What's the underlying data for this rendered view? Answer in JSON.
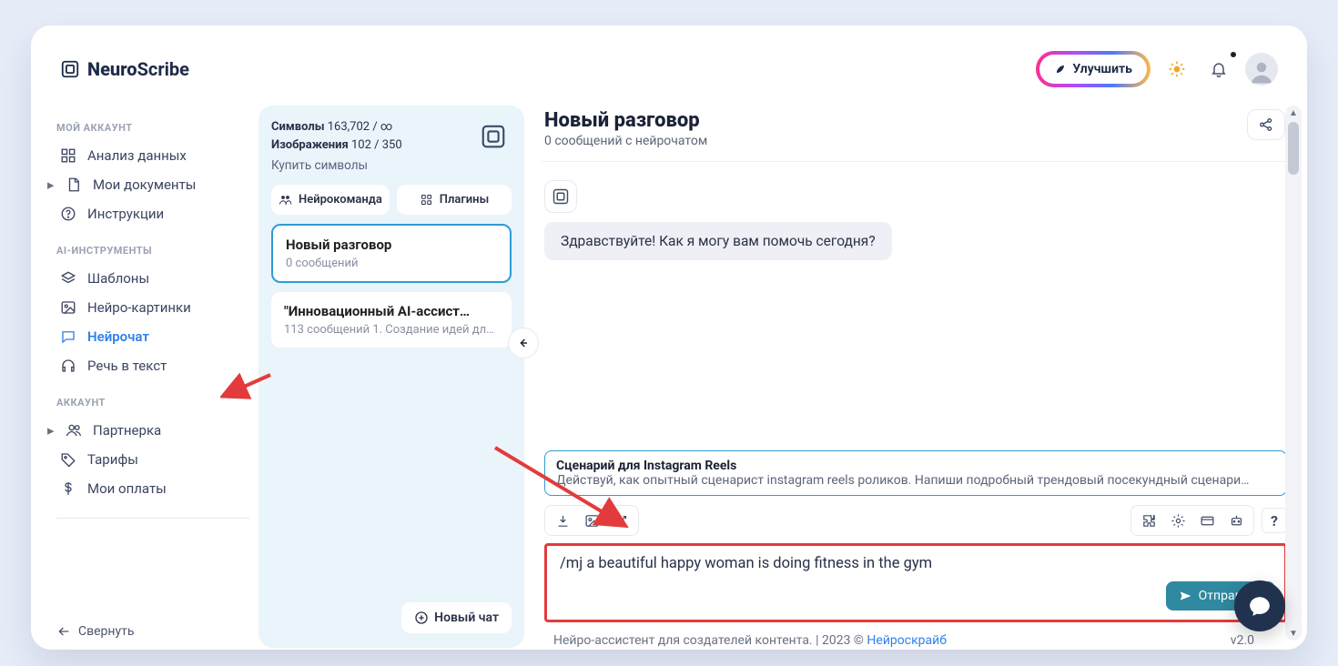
{
  "brand": {
    "bold": "Neuro",
    "light": "Scribe"
  },
  "topbar": {
    "upgrade": "Улучшить"
  },
  "sidebar": {
    "sec1_title": "МОЙ АККАУНТ",
    "sec1": [
      {
        "label": "Анализ данных"
      },
      {
        "label": "Мои документы",
        "caret": true
      },
      {
        "label": "Инструкции"
      }
    ],
    "sec2_title": "AI-ИНСТРУМЕНТЫ",
    "sec2": [
      {
        "label": "Шаблоны"
      },
      {
        "label": "Нейро-картинки"
      },
      {
        "label": "Нейрочат",
        "active": true
      },
      {
        "label": "Речь в текст"
      }
    ],
    "sec3_title": "АККАУНТ",
    "sec3": [
      {
        "label": "Партнерка",
        "caret": true
      },
      {
        "label": "Тарифы"
      },
      {
        "label": "Мои оплаты"
      }
    ],
    "collapse": "Свернуть"
  },
  "stats": {
    "symbols_label": "Символы",
    "symbols_value": "163,702 / ∞",
    "images_label": "Изображения",
    "images_value": "102 / 350",
    "buy": "Купить символы"
  },
  "pills": {
    "team": "Нейрокоманда",
    "plugins": "Плагины"
  },
  "convos": {
    "0": {
      "title": "Новый разговор",
      "sub": "0 сообщений"
    },
    "1": {
      "title": "\"Инновационный AI-ассист…",
      "sub": "113 сообщений 1. Создание идей для…"
    }
  },
  "new_chat": "Новый чат",
  "chat": {
    "title": "Новый разговор",
    "subtitle": "0 сообщений с нейрочатом",
    "greeting": "Здравствуйте! Как я могу вам помочь сегодня?"
  },
  "scenario": {
    "title": "Сценарий для Instagram Reels",
    "body": "Действуй, как опытный сценарист instagram reels роликов. Напиши подробный трендовый посекундный сценари…"
  },
  "composer": {
    "text": "/mj a beautiful happy woman is doing fitness in the gym",
    "send": "Отправить"
  },
  "footer": {
    "text": "Нейро-ассистент для создателей контента.  | 2023 © ",
    "link": "Нейроскрайб",
    "version": "v2.0"
  }
}
